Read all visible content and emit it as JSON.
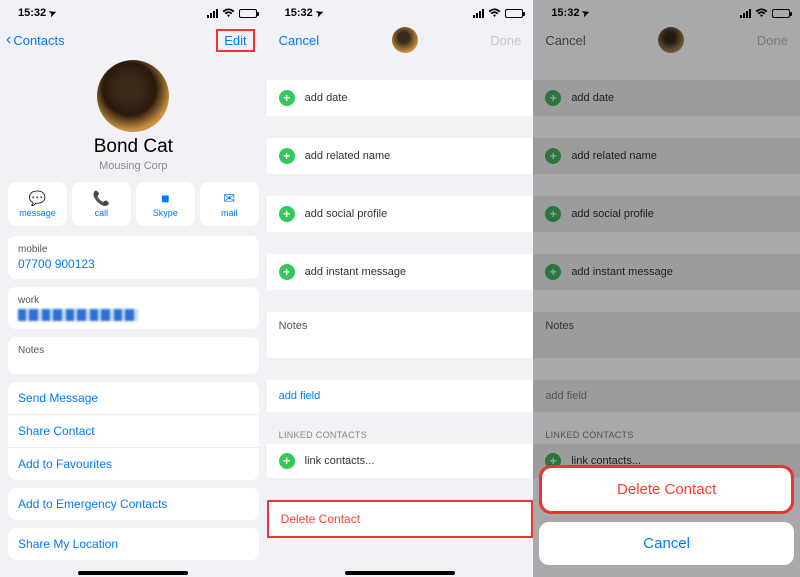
{
  "status": {
    "time": "15:32",
    "loc_icon": "➤"
  },
  "panel1": {
    "back": "Contacts",
    "edit": "Edit",
    "name": "Bond Cat",
    "company": "Mousing Corp",
    "actions": {
      "message": "message",
      "call": "call",
      "video": "Skype",
      "mail": "mail"
    },
    "mobile_label": "mobile",
    "mobile_value": "07700 900123",
    "work_label": "work",
    "notes": "Notes",
    "links": {
      "send": "Send Message",
      "share": "Share Contact",
      "fav": "Add to Favourites",
      "emerg": "Add to Emergency Contacts",
      "loc": "Share My Location"
    }
  },
  "panel2": {
    "cancel": "Cancel",
    "done": "Done",
    "rows": {
      "date": "add date",
      "related": "add related name",
      "social": "add social profile",
      "im": "add instant message"
    },
    "notes": "Notes",
    "addfield": "add field",
    "linked_h": "LINKED CONTACTS",
    "linkc": "link contacts...",
    "delete": "Delete Contact"
  },
  "panel3": {
    "cancel": "Cancel",
    "done": "Done",
    "sheet_delete": "Delete Contact",
    "sheet_cancel": "Cancel"
  }
}
